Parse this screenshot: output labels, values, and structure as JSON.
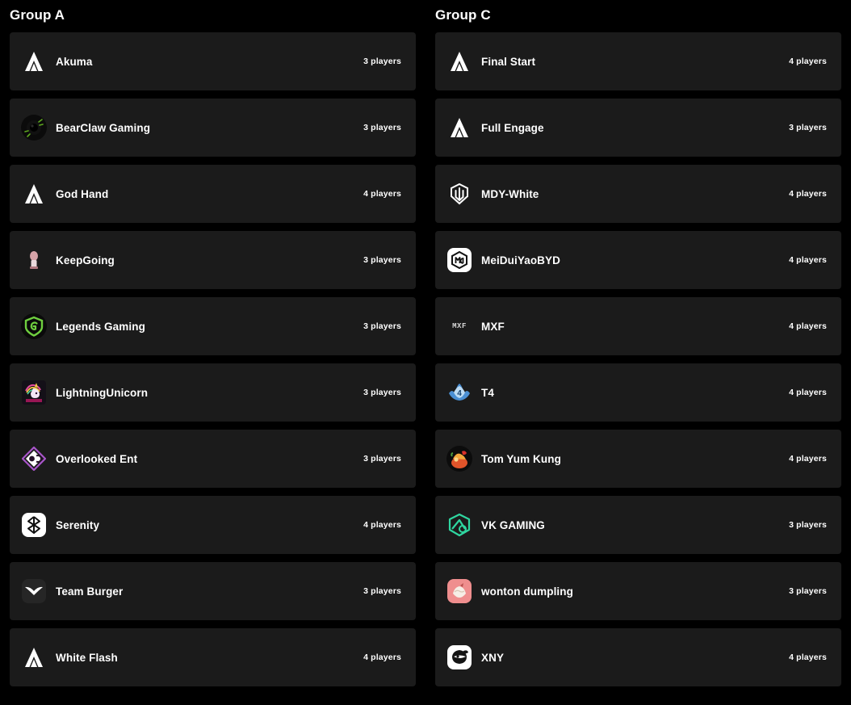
{
  "page": {
    "background": "#000000",
    "card_background": "#1b1b1b",
    "text_color": "#ffffff"
  },
  "groups": [
    {
      "title": "Group A",
      "teams": [
        {
          "name": "Akuma",
          "players": "3 players",
          "logo": "apex-chevron-icon",
          "logo_color": "#ffffff"
        },
        {
          "name": "BearClaw Gaming",
          "players": "3 players",
          "logo": "bearclaw-icon",
          "logo_color": "#5ea81f"
        },
        {
          "name": "God Hand",
          "players": "4 players",
          "logo": "apex-chevron-icon",
          "logo_color": "#ffffff"
        },
        {
          "name": "KeepGoing",
          "players": "3 players",
          "logo": "keepgoing-icon",
          "logo_color": "#d6a3a8"
        },
        {
          "name": "Legends Gaming",
          "players": "3 players",
          "logo": "legends-shield-icon",
          "logo_color": "#6fcf3f"
        },
        {
          "name": "LightningUnicorn",
          "players": "3 players",
          "logo": "unicorn-icon",
          "logo_color": "#e84ba0"
        },
        {
          "name": "Overlooked Ent",
          "players": "3 players",
          "logo": "overlooked-diamond-icon",
          "logo_color": "#a855c9"
        },
        {
          "name": "Serenity",
          "players": "4 players",
          "logo": "serenity-knot-icon",
          "logo_color": "#1a1a1a"
        },
        {
          "name": "Team Burger",
          "players": "3 players",
          "logo": "burger-wings-icon",
          "logo_color": "#ffffff"
        },
        {
          "name": "White Flash",
          "players": "4 players",
          "logo": "apex-chevron-icon",
          "logo_color": "#ffffff"
        }
      ]
    },
    {
      "title": "Group C",
      "teams": [
        {
          "name": "Final Start",
          "players": "4 players",
          "logo": "apex-chevron-icon",
          "logo_color": "#ffffff"
        },
        {
          "name": "Full Engage",
          "players": "3 players",
          "logo": "apex-chevron-icon",
          "logo_color": "#ffffff"
        },
        {
          "name": "MDY-White",
          "players": "4 players",
          "logo": "mdy-crest-icon",
          "logo_color": "#ffffff"
        },
        {
          "name": "MeiDuiYaoBYD",
          "players": "4 players",
          "logo": "mdy-badge-icon",
          "logo_color": "#1a1a1a"
        },
        {
          "name": "MXF",
          "players": "4 players",
          "logo": "mxf-wordmark-icon",
          "logo_color": "#d8d8d8"
        },
        {
          "name": "T4",
          "players": "4 players",
          "logo": "t4-crown-icon",
          "logo_color": "#4a8fd4"
        },
        {
          "name": "Tom Yum Kung",
          "players": "4 players",
          "logo": "tomyumkung-icon",
          "logo_color": "#e06a2a"
        },
        {
          "name": "VK GAMING",
          "players": "3 players",
          "logo": "vk-hex-icon",
          "logo_color": "#2fd6a0"
        },
        {
          "name": "wonton dumpling",
          "players": "3 players",
          "logo": "dumpling-icon",
          "logo_color": "#ef8e8e"
        },
        {
          "name": "XNY",
          "players": "4 players",
          "logo": "xny-ninja-icon",
          "logo_color": "#1a1a1a"
        }
      ]
    }
  ]
}
